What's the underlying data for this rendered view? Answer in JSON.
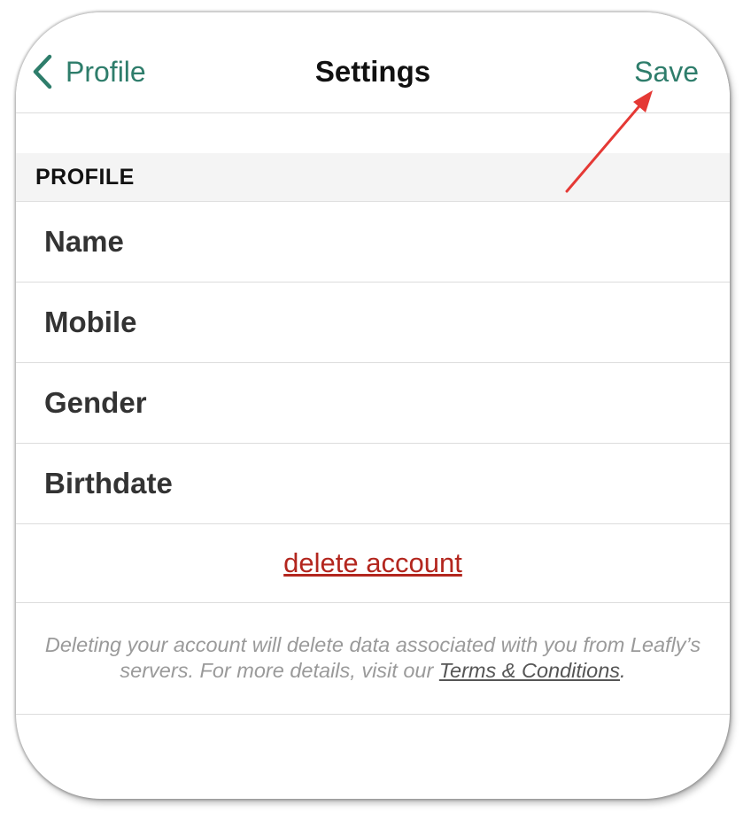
{
  "navbar": {
    "back_label": "Profile",
    "title": "Settings",
    "save_label": "Save"
  },
  "section": {
    "header": "PROFILE",
    "rows": [
      {
        "label": "Name"
      },
      {
        "label": "Mobile"
      },
      {
        "label": "Gender"
      },
      {
        "label": "Birthdate"
      }
    ]
  },
  "delete_link": "delete account",
  "disclaimer": {
    "text": "Deleting your account will delete data associated with you from Leafly’s servers. For more details, visit our ",
    "link": "Terms & Conditions",
    "end": "."
  },
  "colors": {
    "accent": "#2e7d6b",
    "danger": "#b3261e",
    "annotation_arrow": "#e53935"
  },
  "icons": {
    "back": "chevron-left-icon",
    "annotation": "red-arrow-annotation"
  }
}
